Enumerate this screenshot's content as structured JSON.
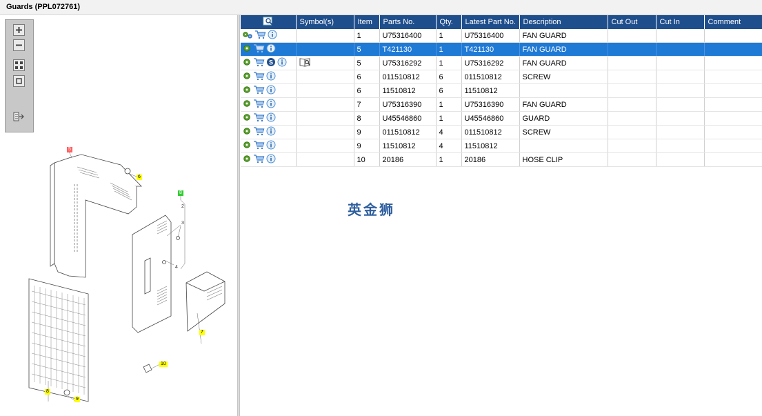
{
  "window": {
    "title": "Guards (PPL072761)"
  },
  "toolbar": {
    "buttons": [
      {
        "name": "zoom-in",
        "icon": "plus-icon"
      },
      {
        "name": "zoom-out",
        "icon": "minus-icon"
      },
      {
        "name": "fit-all",
        "icon": "grid-icon"
      },
      {
        "name": "actual-size",
        "icon": "square-icon"
      },
      {
        "name": "export",
        "icon": "export-icon"
      }
    ]
  },
  "callouts": [
    {
      "label": "5",
      "color": "red"
    },
    {
      "label": "6",
      "color": "yellow"
    },
    {
      "label": "8",
      "color": "green"
    },
    {
      "label": "2",
      "color": "plain"
    },
    {
      "label": "3",
      "color": "plain"
    },
    {
      "label": "4",
      "color": "plain"
    },
    {
      "label": "7",
      "color": "yellow"
    },
    {
      "label": "10",
      "color": "yellow"
    },
    {
      "label": "8",
      "color": "yellow"
    },
    {
      "label": "9",
      "color": "yellow"
    }
  ],
  "table": {
    "columns": [
      "Symbol(s)",
      "Item",
      "Parts No.",
      "Qty.",
      "Latest Part No.",
      "Description",
      "Cut Out",
      "Cut In",
      "Comment"
    ],
    "rows": [
      {
        "item": "1",
        "part": "U75316400",
        "qty": "1",
        "latest": "U75316400",
        "desc": "FAN GUARD",
        "icons": [
          "gears-icon",
          "cart-icon",
          "info-icon"
        ],
        "symbol": ""
      },
      {
        "item": "5",
        "part": "T421130",
        "qty": "1",
        "latest": "T421130",
        "desc": "FAN GUARD",
        "icons": [
          "gear-icon",
          "cart-icon",
          "info-icon"
        ],
        "symbol": "",
        "selected": true
      },
      {
        "item": "5",
        "part": "U75316292",
        "qty": "1",
        "latest": "U75316292",
        "desc": "FAN GUARD",
        "icons": [
          "gear-icon",
          "cart-icon",
          "s-icon",
          "info-icon"
        ],
        "symbol": "book-icon"
      },
      {
        "item": "6",
        "part": "011510812",
        "qty": "6",
        "latest": "011510812",
        "desc": "SCREW",
        "icons": [
          "gear-icon",
          "cart-icon",
          "info-icon"
        ],
        "symbol": ""
      },
      {
        "item": "6",
        "part": "11510812",
        "qty": "6",
        "latest": "11510812",
        "desc": "",
        "icons": [
          "gear-icon",
          "cart-icon",
          "info-icon"
        ],
        "symbol": ""
      },
      {
        "item": "7",
        "part": "U75316390",
        "qty": "1",
        "latest": "U75316390",
        "desc": "FAN GUARD",
        "icons": [
          "gear-icon",
          "cart-icon",
          "info-icon"
        ],
        "symbol": ""
      },
      {
        "item": "8",
        "part": "U45546860",
        "qty": "1",
        "latest": "U45546860",
        "desc": "GUARD",
        "icons": [
          "gear-icon",
          "cart-icon",
          "info-icon"
        ],
        "symbol": ""
      },
      {
        "item": "9",
        "part": "011510812",
        "qty": "4",
        "latest": "011510812",
        "desc": "SCREW",
        "icons": [
          "gear-icon",
          "cart-icon",
          "info-icon"
        ],
        "symbol": ""
      },
      {
        "item": "9",
        "part": "11510812",
        "qty": "4",
        "latest": "11510812",
        "desc": "",
        "icons": [
          "gear-icon",
          "cart-icon",
          "info-icon"
        ],
        "symbol": ""
      },
      {
        "item": "10",
        "part": "20186",
        "qty": "1",
        "latest": "20186",
        "desc": "HOSE CLIP",
        "icons": [
          "gear-icon",
          "cart-icon",
          "info-icon"
        ],
        "symbol": ""
      }
    ]
  },
  "watermark": "英金狮",
  "colors": {
    "header": "#1f4e8c",
    "selected": "#1f7ad6",
    "gear": "#5aa02c",
    "cart": "#3a7bc8",
    "info": "#4a8fd6"
  }
}
